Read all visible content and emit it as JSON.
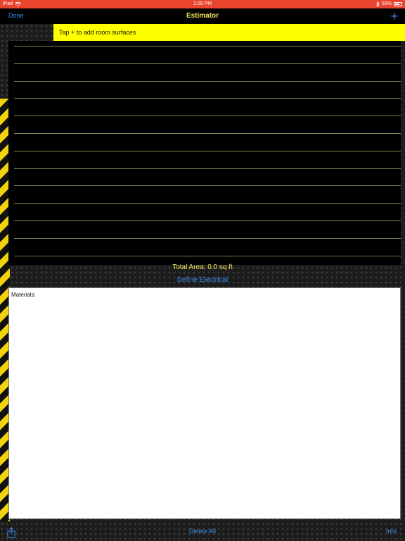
{
  "status_bar": {
    "device": "iPad",
    "time": "1:29 PM",
    "battery": "55%",
    "battery_level": 0.55,
    "color": "#e8442e"
  },
  "nav": {
    "done_label": "Done",
    "title": "Estimator",
    "add_label": "+"
  },
  "hint": {
    "text": "Tap + to add room surfaces",
    "color": "#ffff00"
  },
  "surfaces": {
    "rows": []
  },
  "totals": {
    "total_area": "Total Area:  0.0 sq ft",
    "define_electrical_label": "Define Electrical"
  },
  "materials": {
    "label": "Materials:",
    "text": ""
  },
  "bottom_bar": {
    "share_icon": "share-icon",
    "delete_all_label": "Delete All",
    "info_label": "Info"
  },
  "colors": {
    "accent": "#3b8eea",
    "title": "#f0e25a",
    "hazard_stripe": "#f2d20a"
  }
}
